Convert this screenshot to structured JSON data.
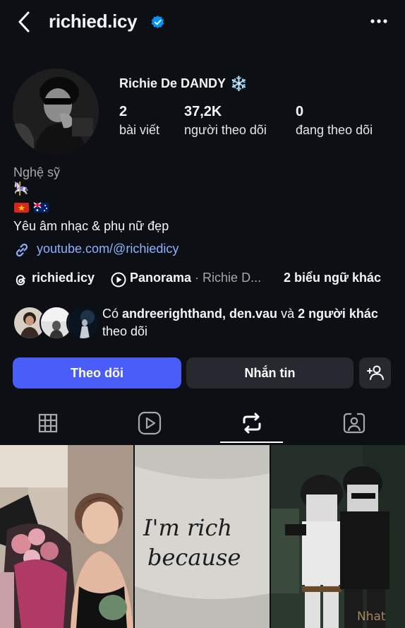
{
  "header": {
    "username": "richied.icy",
    "back_icon": "chevron-left-icon",
    "verified_icon": "verified-badge-icon",
    "more_icon": "more-horizontal-icon"
  },
  "profile": {
    "display_name": "Richie De DANDY",
    "name_emoji": "❄️",
    "stats": {
      "posts": {
        "value": "2",
        "label": "bài viết"
      },
      "followers": {
        "value": "37,2K",
        "label": "người theo dõi"
      },
      "following": {
        "value": "0",
        "label": "đang theo dõi"
      }
    },
    "category": "Nghệ sỹ",
    "bio_line1": "🎠",
    "bio_line2": "🇻🇳 🇦🇺",
    "bio_line3": "Yêu âm nhạc & phụ nữ đẹp",
    "link": "youtube.com/@richiedicy"
  },
  "chips": {
    "threads_handle": "richied.icy",
    "panorama_label": "Panorama",
    "panorama_sub": " · Richie D...",
    "more_banners": "2 biểu ngữ khác"
  },
  "followed_by": {
    "prefix": "Có ",
    "names": "andreerighthand, den.vau",
    "mid": " và ",
    "others": "2 người khác",
    "suffix": " theo dõi"
  },
  "actions": {
    "follow": "Theo dõi",
    "message": "Nhắn tin",
    "add_person_icon": "add-person-icon"
  },
  "tabs": {
    "items": [
      "grid-icon",
      "reels-icon",
      "reposts-icon",
      "tagged-icon"
    ],
    "active": "reposts-icon"
  },
  "posts": {
    "tile2_line1": "I'm rich",
    "tile2_line2": "because",
    "tile3_watermark": "Nhat"
  },
  "colors": {
    "background": "#0c1014",
    "follow_button": "#4a5df9",
    "secondary_button": "#262a30",
    "verified": "#0095f6",
    "link": "#8fb0ff"
  }
}
